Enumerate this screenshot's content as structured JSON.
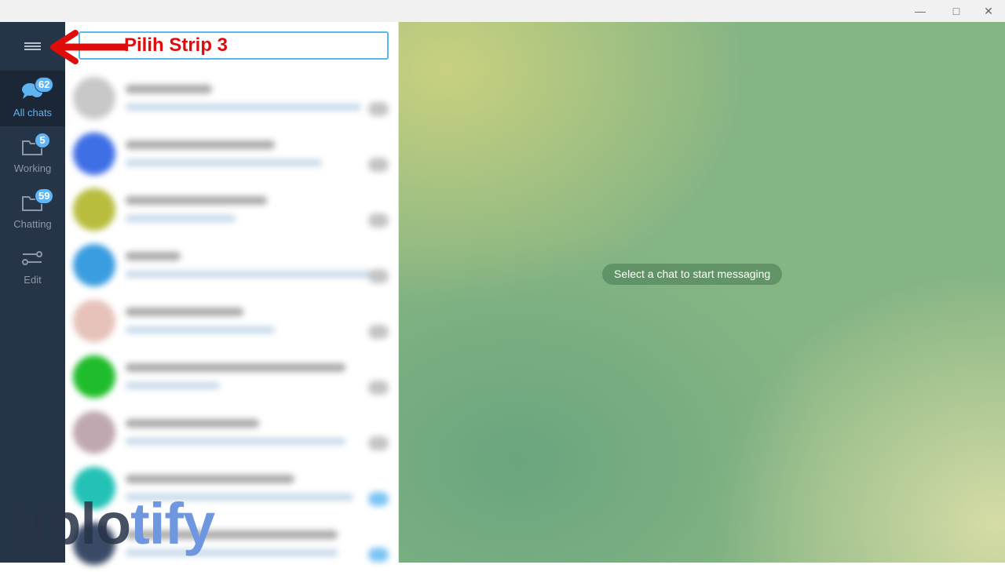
{
  "window": {
    "controls": [
      "minimize",
      "maximize",
      "close"
    ]
  },
  "sidebar": {
    "menu_icon": "hamburger-icon",
    "folders": [
      {
        "label": "All chats",
        "badge": "62",
        "icon": "chat-bubbles-icon",
        "active": true
      },
      {
        "label": "Working",
        "badge": "5",
        "icon": "folder-icon"
      },
      {
        "label": "Chatting",
        "badge": "59",
        "icon": "folder-icon"
      },
      {
        "label": "Edit",
        "icon": "sliders-icon"
      }
    ]
  },
  "chat_list": {
    "avatar_colors": [
      "#c8c8c8",
      "#3f6fe6",
      "#b9bd3e",
      "#3a9de0",
      "#e6c2ba",
      "#1fbd2b",
      "#c0a8b0",
      "#24c2b6",
      "#3a4a66"
    ]
  },
  "main": {
    "empty_message": "Select a chat to start messaging"
  },
  "annotation": {
    "text": "Pilih Strip 3",
    "color": "#e00c0c"
  },
  "watermark": {
    "part1": "uplo",
    "part2": "tify"
  },
  "colors": {
    "sidebar": "#263447",
    "accent": "#5eb5f7"
  }
}
